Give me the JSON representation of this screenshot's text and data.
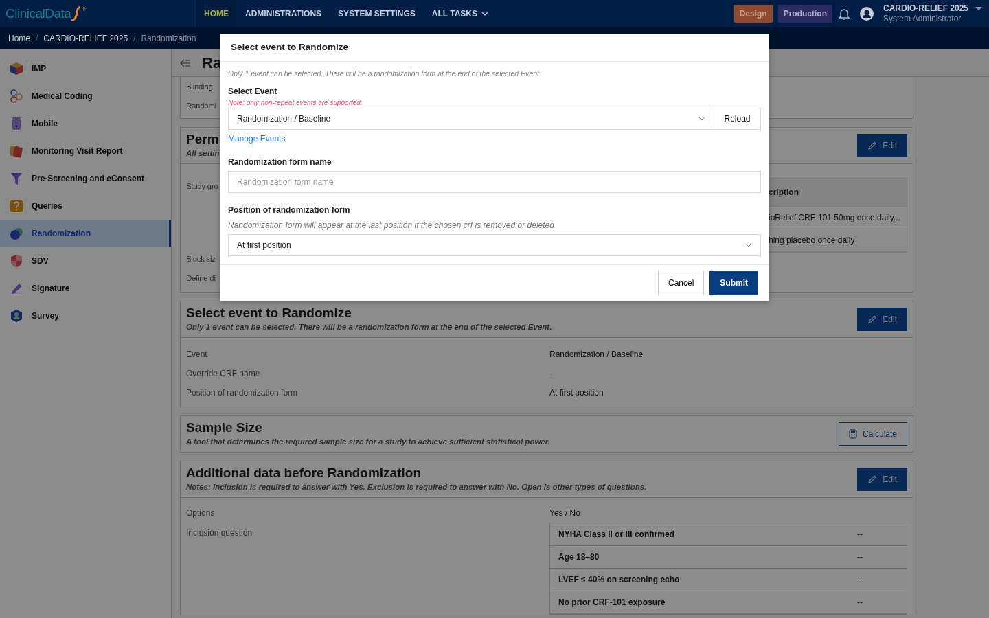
{
  "navbar": {
    "logo": "ClinicalData",
    "logo_mark": "®",
    "menu": [
      {
        "label": "HOME",
        "selected": true,
        "dropdown": false
      },
      {
        "label": "ADMINISTRATIONS",
        "selected": false,
        "dropdown": false
      },
      {
        "label": "SYSTEM SETTINGS",
        "selected": false,
        "dropdown": false
      },
      {
        "label": "ALL TASKS",
        "selected": false,
        "dropdown": true
      }
    ],
    "env_badges": [
      {
        "label": "Design",
        "color": "#8f4a2f"
      },
      {
        "label": "Production",
        "color": "#2b2a62"
      }
    ],
    "user": {
      "study": "CARDIO-RELIEF 2025",
      "role": "System Administrator"
    }
  },
  "breadcrumb": [
    {
      "label": "Home",
      "current": false
    },
    {
      "separator": "/",
      "label": "CARDIO-RELIEF 2025",
      "current": false
    },
    {
      "separator": "/",
      "label": "Randomization",
      "current": true
    }
  ],
  "sidebar": {
    "items": [
      {
        "label": "IMP",
        "selected": false
      },
      {
        "label": "Medical Coding",
        "selected": false
      },
      {
        "label": "Mobile",
        "selected": false
      },
      {
        "label": "Monitoring Visit Report",
        "selected": false
      },
      {
        "label": "Pre-Screening and eConsent",
        "selected": false
      },
      {
        "label": "Queries",
        "selected": false
      },
      {
        "label": "Randomization",
        "selected": true
      },
      {
        "label": "SDV",
        "selected": false
      },
      {
        "label": "Signature",
        "selected": false
      },
      {
        "label": "Survey",
        "selected": false
      }
    ]
  },
  "page": {
    "title": "Ra"
  },
  "cards": [
    {
      "kind": "fields",
      "rows": [
        {
          "label": "Blinding"
        },
        {
          "label": "Randomi"
        }
      ]
    },
    {
      "kind": "groups",
      "title": "Perm",
      "subtitle": "All settin",
      "button": {
        "label": "Edit",
        "kind": "edit"
      },
      "rows": [
        {
          "label": "Study gro"
        },
        {
          "label": "Block siz"
        },
        {
          "label": "Define di"
        }
      ],
      "table": {
        "header": "cription",
        "rows": [
          "ioRelief CRF-101 50mg once daily...",
          "hing placebo once daily"
        ]
      }
    },
    {
      "kind": "details",
      "title": "Select event to Randomize",
      "subtitle": "Only 1 event can be selected. There will be a randomization form at the end of the selected Event.",
      "button": {
        "label": "Edit",
        "kind": "edit"
      },
      "rows": [
        {
          "label": "Event",
          "value": "Randomization / Baseline"
        },
        {
          "label": "Override CRF name",
          "value": "--"
        },
        {
          "label": "Position of randomization form",
          "value": "At first position"
        }
      ]
    },
    {
      "kind": "header",
      "title": "Sample Size",
      "subtitle": "A tool that determines the required sample size for a study to achieve sufficient statistical power.",
      "button": {
        "label": "Calculate",
        "kind": "calculate"
      }
    },
    {
      "kind": "questions",
      "title": "Additional data before Randomization",
      "subtitle": "Notes: Inclusion is required to answer with Yes. Exclusion is required to answer with No. Open is other types of questions.",
      "button": {
        "label": "Edit",
        "kind": "edit"
      },
      "options_label": "Options",
      "options_value": "Yes / No",
      "question_label": "Inclusion question",
      "questions": [
        {
          "text": "NYHA Class II or III confirmed",
          "answer": "--"
        },
        {
          "text": "Age 18–80",
          "answer": "--"
        },
        {
          "text": "LVEF ≤ 40% on screening echo",
          "answer": "--"
        },
        {
          "text": "No prior CRF-101 exposure",
          "answer": "--"
        }
      ]
    }
  ],
  "modal": {
    "title": "Select event to Randomize",
    "note": "Only 1 event can be selected. There will be a randomization form at the end of the selected Event.",
    "event_label": "Select Event",
    "event_warning": "Note: only non-repeat events are supported.",
    "event_value": "Randomization / Baseline",
    "reload": "Reload",
    "manage_link": "Manage Events",
    "name_label": "Randomization form name",
    "name_placeholder": "Randomization form name",
    "position_label": "Position of randomization form",
    "position_hint": "Randomization form will appear at the last position if the chosen crf is removed or deleted",
    "position_value": "At first position",
    "cancel": "Cancel",
    "submit": "Submit"
  }
}
